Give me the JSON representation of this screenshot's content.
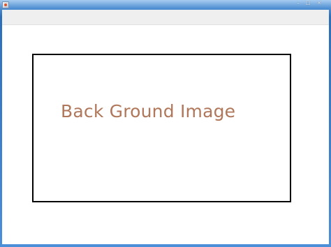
{
  "window": {
    "title": "",
    "controls": {
      "minimize": "–",
      "maximize": "□",
      "close": "×"
    }
  },
  "canvas": {
    "placeholder_text": "Back Ground Image",
    "text_color": "#b0775a",
    "frame_color": "#000000"
  },
  "icons": {
    "app": "java-app-icon",
    "minimize": "minimize-icon",
    "maximize": "maximize-icon",
    "close": "close-icon"
  }
}
